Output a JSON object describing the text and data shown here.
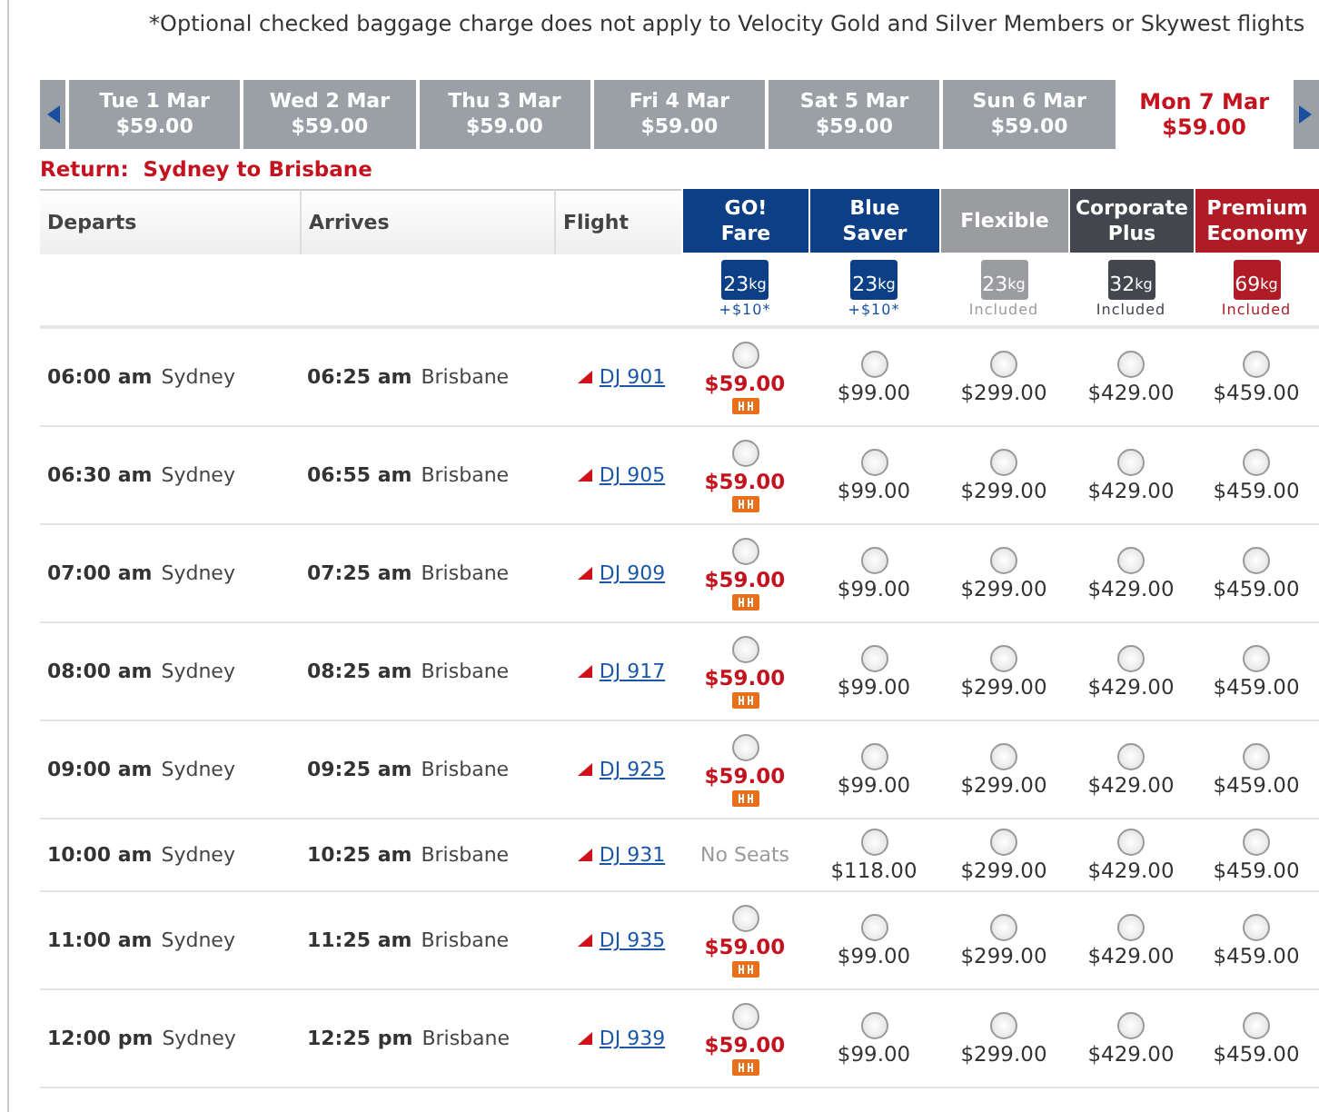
{
  "note": "*Optional checked baggage charge does not apply to Velocity Gold and Silver Members or Skywest flights",
  "dates": [
    {
      "day": "Tue 1 Mar",
      "price": "$59.00",
      "selected": false
    },
    {
      "day": "Wed 2 Mar",
      "price": "$59.00",
      "selected": false
    },
    {
      "day": "Thu 3 Mar",
      "price": "$59.00",
      "selected": false
    },
    {
      "day": "Fri 4 Mar",
      "price": "$59.00",
      "selected": false
    },
    {
      "day": "Sat 5 Mar",
      "price": "$59.00",
      "selected": false
    },
    {
      "day": "Sun 6 Mar",
      "price": "$59.00",
      "selected": false
    },
    {
      "day": "Mon 7 Mar",
      "price": "$59.00",
      "selected": true
    }
  ],
  "return_heading": "Return:  Sydney to Brisbane",
  "columns": [
    "Departs",
    "Arrives",
    "Flight"
  ],
  "fare_classes": [
    {
      "name": "GO! Fare",
      "color": "#0c3f86",
      "weight": "23",
      "unit": "kg",
      "baggage": "+$10*"
    },
    {
      "name": "Blue Saver",
      "color": "#0c3f86",
      "weight": "23",
      "unit": "kg",
      "baggage": "+$10*"
    },
    {
      "name": "Flexible",
      "color": "#9a9ca0",
      "weight": "23",
      "unit": "kg",
      "baggage": "Included"
    },
    {
      "name": "Corporate Plus",
      "color": "#44464e",
      "weight": "32",
      "unit": "kg",
      "baggage": "Included"
    },
    {
      "name": "Premium Economy",
      "color": "#b01c26",
      "weight": "69",
      "unit": "kg",
      "baggage": "Included"
    }
  ],
  "flights": [
    {
      "depart_time": "06:00 am",
      "depart_city": "Sydney",
      "arrive_time": "06:25 am",
      "arrive_city": "Brisbane",
      "flight": "DJ 901",
      "fares": [
        {
          "kind": "promo",
          "price": "$59.00",
          "selected": false
        },
        {
          "kind": "fare",
          "price": "$99.00",
          "selected": false
        },
        {
          "kind": "fare",
          "price": "$299.00",
          "selected": false
        },
        {
          "kind": "fare",
          "price": "$429.00",
          "selected": false
        },
        {
          "kind": "fare",
          "price": "$459.00",
          "selected": false
        }
      ]
    },
    {
      "depart_time": "06:30 am",
      "depart_city": "Sydney",
      "arrive_time": "06:55 am",
      "arrive_city": "Brisbane",
      "flight": "DJ 905",
      "fares": [
        {
          "kind": "promo",
          "price": "$59.00",
          "selected": false
        },
        {
          "kind": "fare",
          "price": "$99.00",
          "selected": false
        },
        {
          "kind": "fare",
          "price": "$299.00",
          "selected": false
        },
        {
          "kind": "fare",
          "price": "$429.00",
          "selected": false
        },
        {
          "kind": "fare",
          "price": "$459.00",
          "selected": false
        }
      ]
    },
    {
      "depart_time": "07:00 am",
      "depart_city": "Sydney",
      "arrive_time": "07:25 am",
      "arrive_city": "Brisbane",
      "flight": "DJ 909",
      "fares": [
        {
          "kind": "promo",
          "price": "$59.00",
          "selected": false
        },
        {
          "kind": "fare",
          "price": "$99.00",
          "selected": false
        },
        {
          "kind": "fare",
          "price": "$299.00",
          "selected": false
        },
        {
          "kind": "fare",
          "price": "$429.00",
          "selected": false
        },
        {
          "kind": "fare",
          "price": "$459.00",
          "selected": false
        }
      ]
    },
    {
      "depart_time": "08:00 am",
      "depart_city": "Sydney",
      "arrive_time": "08:25 am",
      "arrive_city": "Brisbane",
      "flight": "DJ 917",
      "fares": [
        {
          "kind": "promo",
          "price": "$59.00",
          "selected": false
        },
        {
          "kind": "fare",
          "price": "$99.00",
          "selected": false
        },
        {
          "kind": "fare",
          "price": "$299.00",
          "selected": false
        },
        {
          "kind": "fare",
          "price": "$429.00",
          "selected": false
        },
        {
          "kind": "fare",
          "price": "$459.00",
          "selected": false
        }
      ]
    },
    {
      "depart_time": "09:00 am",
      "depart_city": "Sydney",
      "arrive_time": "09:25 am",
      "arrive_city": "Brisbane",
      "flight": "DJ 925",
      "fares": [
        {
          "kind": "promo",
          "price": "$59.00",
          "selected": false
        },
        {
          "kind": "fare",
          "price": "$99.00",
          "selected": false
        },
        {
          "kind": "fare",
          "price": "$299.00",
          "selected": false
        },
        {
          "kind": "fare",
          "price": "$429.00",
          "selected": false
        },
        {
          "kind": "fare",
          "price": "$459.00",
          "selected": false
        }
      ]
    },
    {
      "depart_time": "10:00 am",
      "depart_city": "Sydney",
      "arrive_time": "10:25 am",
      "arrive_city": "Brisbane",
      "flight": "DJ 931",
      "fares": [
        {
          "kind": "no_seats",
          "text": "No Seats"
        },
        {
          "kind": "fare",
          "price": "$118.00",
          "selected": false
        },
        {
          "kind": "fare",
          "price": "$299.00",
          "selected": false
        },
        {
          "kind": "fare",
          "price": "$429.00",
          "selected": false
        },
        {
          "kind": "fare",
          "price": "$459.00",
          "selected": false
        }
      ]
    },
    {
      "depart_time": "11:00 am",
      "depart_city": "Sydney",
      "arrive_time": "11:25 am",
      "arrive_city": "Brisbane",
      "flight": "DJ 935",
      "fares": [
        {
          "kind": "promo",
          "price": "$59.00",
          "selected": false
        },
        {
          "kind": "fare",
          "price": "$99.00",
          "selected": false
        },
        {
          "kind": "fare",
          "price": "$299.00",
          "selected": false
        },
        {
          "kind": "fare",
          "price": "$429.00",
          "selected": false
        },
        {
          "kind": "fare",
          "price": "$459.00",
          "selected": false
        }
      ]
    },
    {
      "depart_time": "12:00 pm",
      "depart_city": "Sydney",
      "arrive_time": "12:25 pm",
      "arrive_city": "Brisbane",
      "flight": "DJ 939",
      "fares": [
        {
          "kind": "promo",
          "price": "$59.00",
          "selected": false
        },
        {
          "kind": "fare",
          "price": "$99.00",
          "selected": false
        },
        {
          "kind": "fare",
          "price": "$299.00",
          "selected": false
        },
        {
          "kind": "fare",
          "price": "$429.00",
          "selected": false
        },
        {
          "kind": "fare",
          "price": "$459.00",
          "selected": false
        }
      ]
    }
  ]
}
